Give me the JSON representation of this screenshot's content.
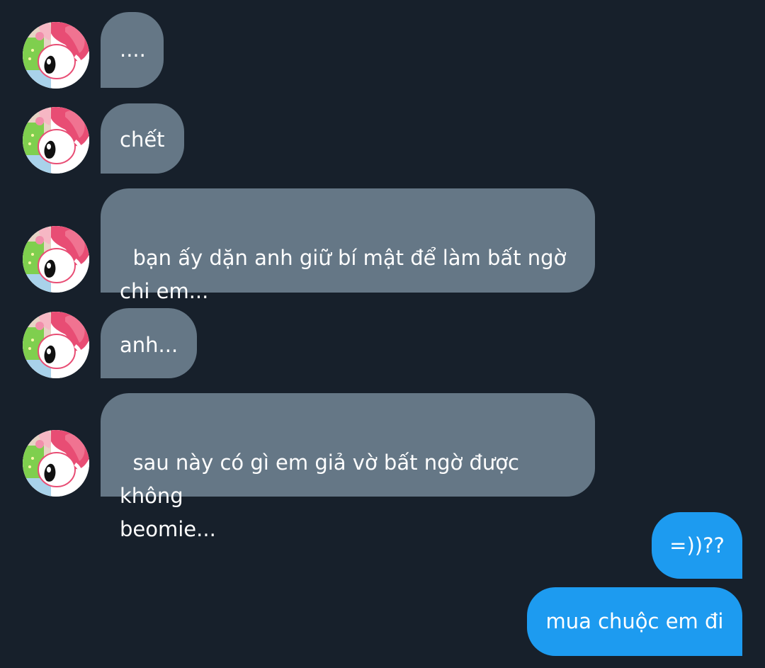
{
  "conversation": {
    "contact_avatar": "my-melody-avatar",
    "colors": {
      "background": "#17202b",
      "incoming_bubble": "#657786",
      "outgoing_bubble": "#1d9bf0",
      "text": "#ffffff"
    },
    "messages": [
      {
        "sender": "contact",
        "text": "...."
      },
      {
        "sender": "contact",
        "text": "chết"
      },
      {
        "sender": "contact",
        "text": "bạn ấy dặn anh giữ bí mật để làm bất ngờ\nchi em..."
      },
      {
        "sender": "contact",
        "text": "anh..."
      },
      {
        "sender": "contact",
        "text": "sau này có gì em giả vờ bất ngờ được không\nbeomie..."
      },
      {
        "sender": "me",
        "text": "=))??"
      },
      {
        "sender": "me",
        "text": "mua chuộc em đi"
      }
    ]
  }
}
